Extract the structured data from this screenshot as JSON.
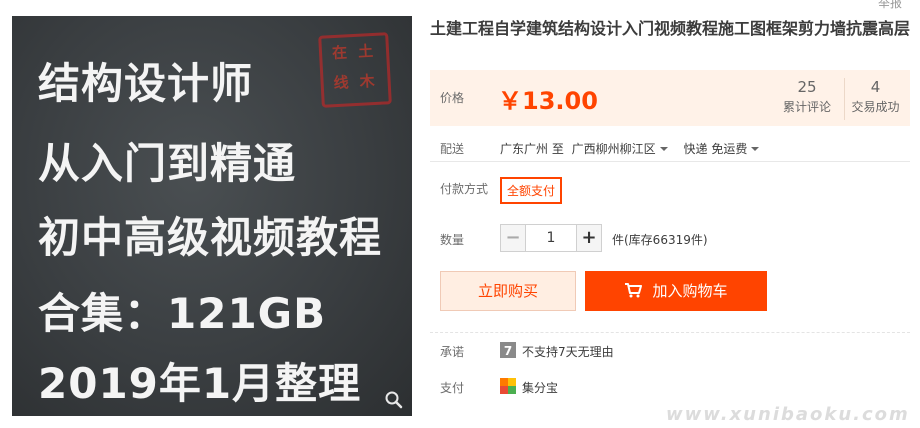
{
  "promo": {
    "lines": [
      "结构设计师",
      "从入门到精通",
      "初中高级视频教程",
      "合集：121GB",
      "2019年1月整理"
    ],
    "seal_chars": [
      "土",
      "木",
      "在",
      "线"
    ]
  },
  "product": {
    "title": "土建工程自学建筑结构设计入门视频教程施工图框架剪力墙抗震高层",
    "corner_text": "举报"
  },
  "price": {
    "label": "价格",
    "value": "￥13.00",
    "reviews_count": "25",
    "reviews_label": "累计评论",
    "deals_count": "4",
    "deals_label": "交易成功"
  },
  "shipping": {
    "label": "配送",
    "from": "广东广州 至",
    "to": "广西柳州柳江区",
    "method": "快递 免运费"
  },
  "payment_method": {
    "label": "付款方式",
    "option": "全额支付"
  },
  "quantity": {
    "label": "数量",
    "minus": "−",
    "value": "1",
    "plus": "+",
    "stock": "件(库存66319件)"
  },
  "actions": {
    "buy_now": "立即购买",
    "add_to_cart": "加入购物车"
  },
  "guarantees": {
    "promise_label": "承诺",
    "promise_text": "不支持7天无理由",
    "pay_label": "支付",
    "pay_text": "集分宝"
  },
  "watermark": "www.xunibaoku.com",
  "colors": {
    "accent": "#ff4400",
    "price_bg": "#fff2e8"
  }
}
